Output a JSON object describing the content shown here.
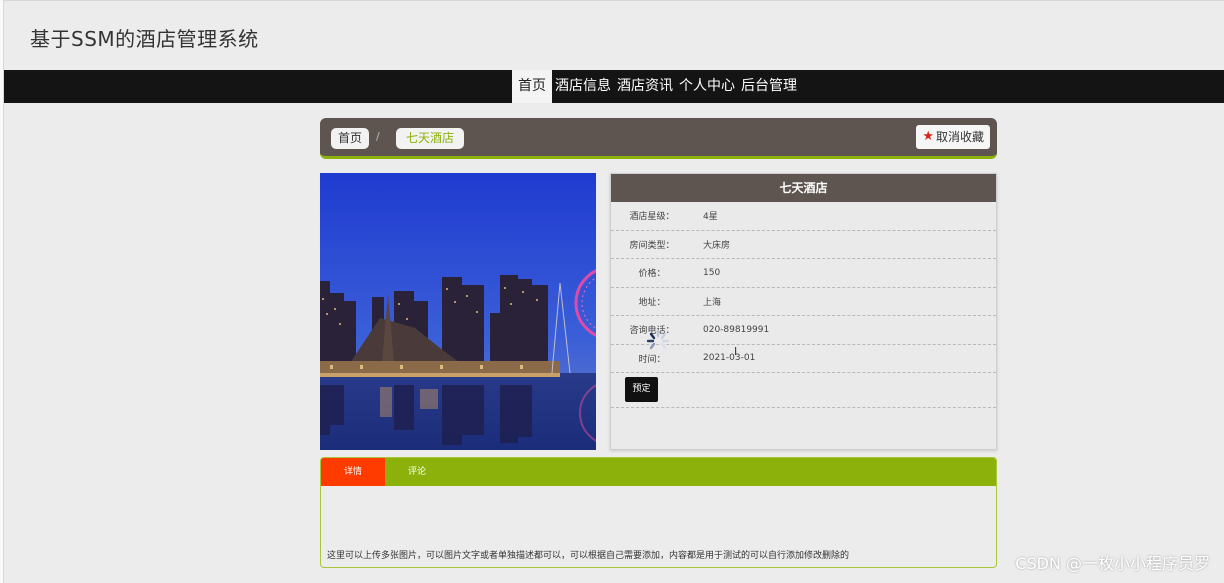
{
  "header": {
    "title": "基于SSM的酒店管理系统"
  },
  "nav": {
    "items": [
      {
        "label": "首页",
        "active": true
      },
      {
        "label": "酒店信息",
        "active": false
      },
      {
        "label": "酒店资讯",
        "active": false
      },
      {
        "label": "个人中心",
        "active": false
      },
      {
        "label": "后台管理",
        "active": false
      }
    ]
  },
  "breadcrumb": {
    "home": "首页",
    "separator": "/",
    "current": "七天酒店"
  },
  "favorite": {
    "icon": "star-icon",
    "label": "取消收藏"
  },
  "hotel": {
    "name": "七天酒店",
    "fields": [
      {
        "label": "酒店星级：",
        "value": "4星"
      },
      {
        "label": "房间类型：",
        "value": "大床房"
      },
      {
        "label": "价格：",
        "value": "150"
      },
      {
        "label": "地址：",
        "value": "上海"
      },
      {
        "label": "咨询电话：",
        "value": "020-89819991"
      },
      {
        "label": "时间：",
        "value": "2021-03-01"
      }
    ],
    "book_label": "预定"
  },
  "tabs": {
    "items": [
      {
        "label": "详情",
        "active": true
      },
      {
        "label": "评论",
        "active": false
      }
    ],
    "detail_text": "这里可以上传多张图片，可以图片文字或者单独描述都可以，可以根据自己需要添加，内容都是用于测试的可以自行添加修改删除的"
  },
  "watermark": "CSDN @一枚小小程序员罗",
  "colors": {
    "nav_bg": "#141414",
    "panel_header": "#5e5551",
    "accent_green": "#8bb10a",
    "active_tab": "#ff3b00"
  }
}
